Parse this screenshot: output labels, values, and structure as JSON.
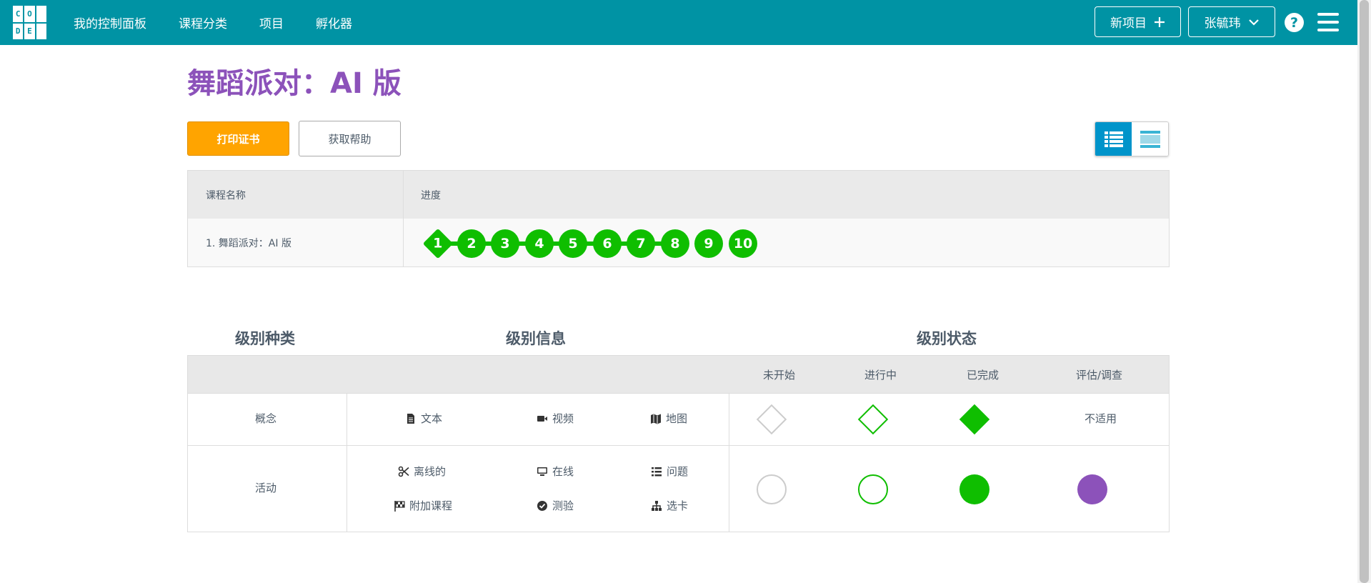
{
  "logo": [
    "C",
    "O",
    "",
    "D",
    "E",
    ""
  ],
  "nav": {
    "items": [
      "我的控制面板",
      "课程分类",
      "项目",
      "孵化器"
    ]
  },
  "header": {
    "new_project": "新项目",
    "user_name": "张毓玮",
    "help": "?"
  },
  "page": {
    "title": "舞蹈派对：AI 版"
  },
  "actions": {
    "print_certificate": "打印证书",
    "get_help": "获取帮助"
  },
  "progress_table": {
    "headers": {
      "lesson_name": "课程名称",
      "progress": "进度"
    },
    "rows": [
      {
        "name": "1. 舞蹈派对：AI 版",
        "levels": [
          "1",
          "2",
          "3",
          "4",
          "5",
          "6",
          "7",
          "8",
          "9",
          "10"
        ]
      }
    ]
  },
  "key": {
    "headings": {
      "level_types": "级别种类",
      "level_info": "级别信息",
      "level_status": "级别状态"
    },
    "status_headers": [
      "未开始",
      "进行中",
      "已完成",
      "评估/调查"
    ],
    "concept": {
      "label": "概念",
      "items": [
        {
          "icon": "document-icon",
          "label": "文本"
        },
        {
          "icon": "video-icon",
          "label": "视频"
        },
        {
          "icon": "map-icon",
          "label": "地图"
        }
      ],
      "assessment": "不适用"
    },
    "activity": {
      "label": "活动",
      "items": [
        {
          "icon": "scissors-icon",
          "label": "离线的"
        },
        {
          "icon": "desktop-icon",
          "label": "在线"
        },
        {
          "icon": "list-icon",
          "label": "问题"
        },
        {
          "icon": "flag-icon",
          "label": "附加课程"
        },
        {
          "icon": "check-circle-icon",
          "label": "测验"
        },
        {
          "icon": "sitemap-icon",
          "label": "选卡"
        }
      ]
    }
  },
  "colors": {
    "topbar": "#0093a4",
    "completed": "#0fbe00",
    "assessment": "#8c52ba",
    "title": "#8c52ba",
    "print_button": "#ffa400"
  }
}
